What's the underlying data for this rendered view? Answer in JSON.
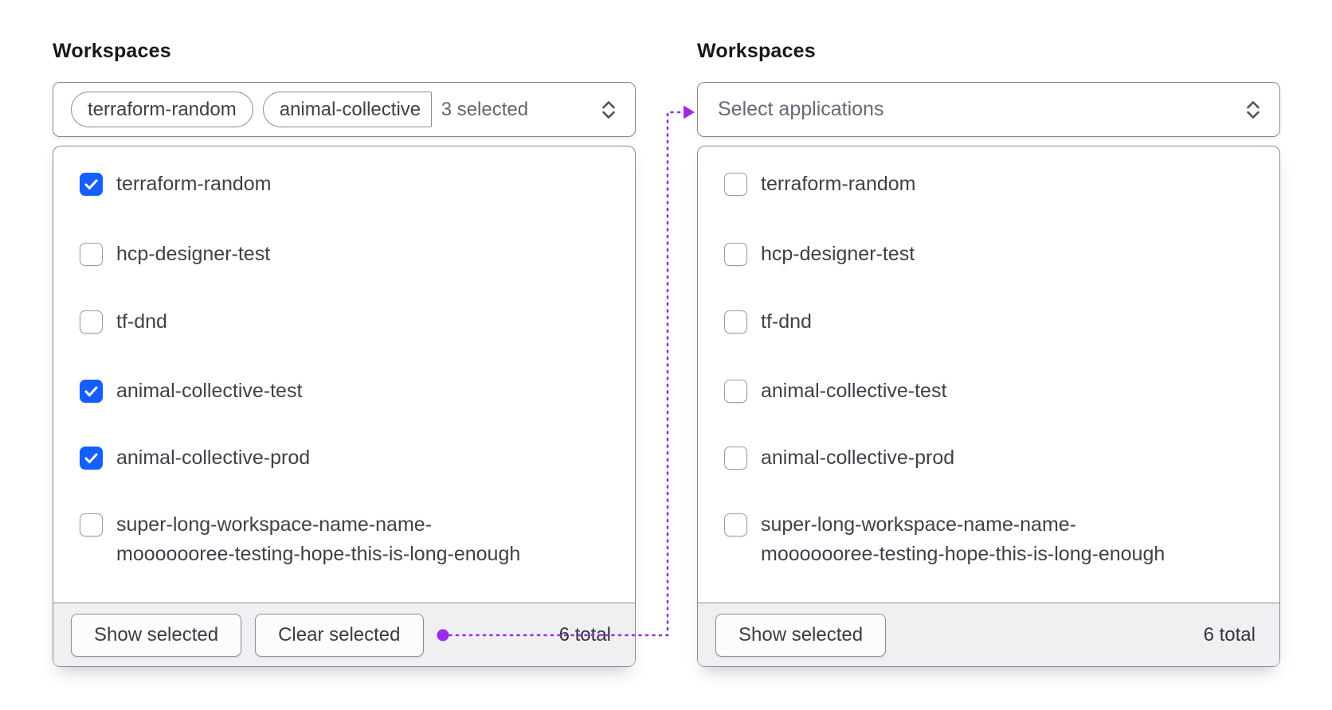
{
  "colors": {
    "accent_blue": "#1360fe",
    "accent_purple": "#9b2be8",
    "border_gray": "#888b94",
    "footer_bg": "#f0f0f2",
    "text_primary": "#3e4149",
    "text_muted": "#656a76"
  },
  "left": {
    "label": "Workspaces",
    "trigger": {
      "tags": [
        "terraform-random",
        "animal-collective"
      ],
      "count_label": "3 selected",
      "chevron_icon": "chevron-up-down"
    },
    "items": [
      {
        "label": "terraform-random",
        "checked": true
      },
      {
        "label": "hcp-designer-test",
        "checked": false
      },
      {
        "label": "tf-dnd",
        "checked": false
      },
      {
        "label": "animal-collective-test",
        "checked": true
      },
      {
        "label": "animal-collective-prod",
        "checked": true
      },
      {
        "lines": [
          "super-long-workspace-name-name-",
          "mooooooree-testing-hope-this-is-long-enough"
        ],
        "checked": false
      }
    ],
    "footer": {
      "show_selected_label": "Show selected",
      "clear_selected_label": "Clear selected",
      "total": "6 total"
    }
  },
  "right": {
    "label": "Workspaces",
    "trigger": {
      "placeholder": "Select applications",
      "chevron_icon": "chevron-up-down"
    },
    "items": [
      {
        "label": "terraform-random",
        "checked": false
      },
      {
        "label": "hcp-designer-test",
        "checked": false
      },
      {
        "label": "tf-dnd",
        "checked": false
      },
      {
        "label": "animal-collective-test",
        "checked": false
      },
      {
        "label": "animal-collective-prod",
        "checked": false
      },
      {
        "lines": [
          "super-long-workspace-name-name-",
          "mooooooree-testing-hope-this-is-long-enough"
        ],
        "checked": false
      }
    ],
    "footer": {
      "show_selected_label": "Show selected",
      "total": "6 total"
    }
  }
}
